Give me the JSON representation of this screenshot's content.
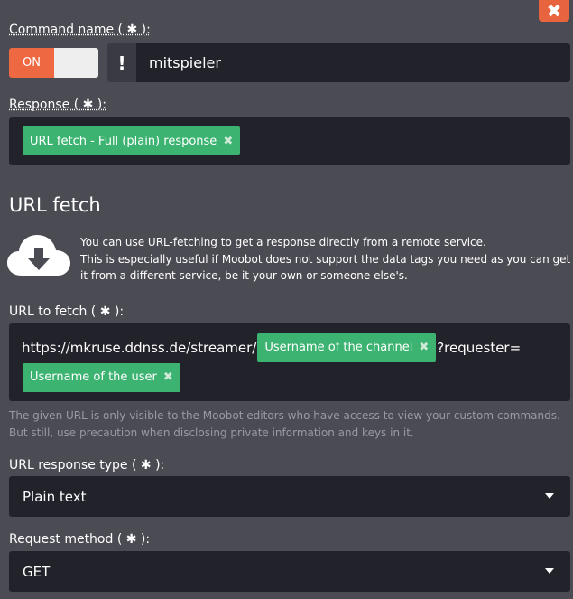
{
  "close_symbol": "✖",
  "command": {
    "label": "Command name ( ✱ ):",
    "toggle_label": "ON",
    "prefix_symbol": "!",
    "value": "mitspieler"
  },
  "response": {
    "label": "Response ( ✱ ):",
    "tag": "URL fetch - Full (plain) response",
    "remove_symbol": "✖"
  },
  "url_fetch": {
    "title": "URL fetch",
    "icon": "cloud-download-icon",
    "info_line1": "You can use URL-fetching to get a response directly from a remote service.",
    "info_line2": "This is especially useful if Moobot does not support the data tags you need as you can get it from a different service, be it your own or someone else's.",
    "url_label": "URL to fetch ( ✱ ):",
    "url_part1": "https://mkruse.ddnss.de/streamer/",
    "tag_channel": "Username of the channel",
    "url_part2": "?requester=",
    "tag_user": "Username of the user",
    "remove_symbol": "✖",
    "hint_line1": "The given URL is only visible to the Moobot editors who have access to view your custom commands.",
    "hint_line2": "But still, use precaution when disclosing private information and keys in it."
  },
  "response_type": {
    "label": "URL response type ( ✱ ):",
    "selected": "Plain text"
  },
  "request_method": {
    "label": "Request method ( ✱ ):",
    "selected": "GET"
  },
  "colors": {
    "background": "#4b4b53",
    "field": "#22222a",
    "accent_orange": "#ee6842",
    "tag_green": "#3cb371"
  }
}
